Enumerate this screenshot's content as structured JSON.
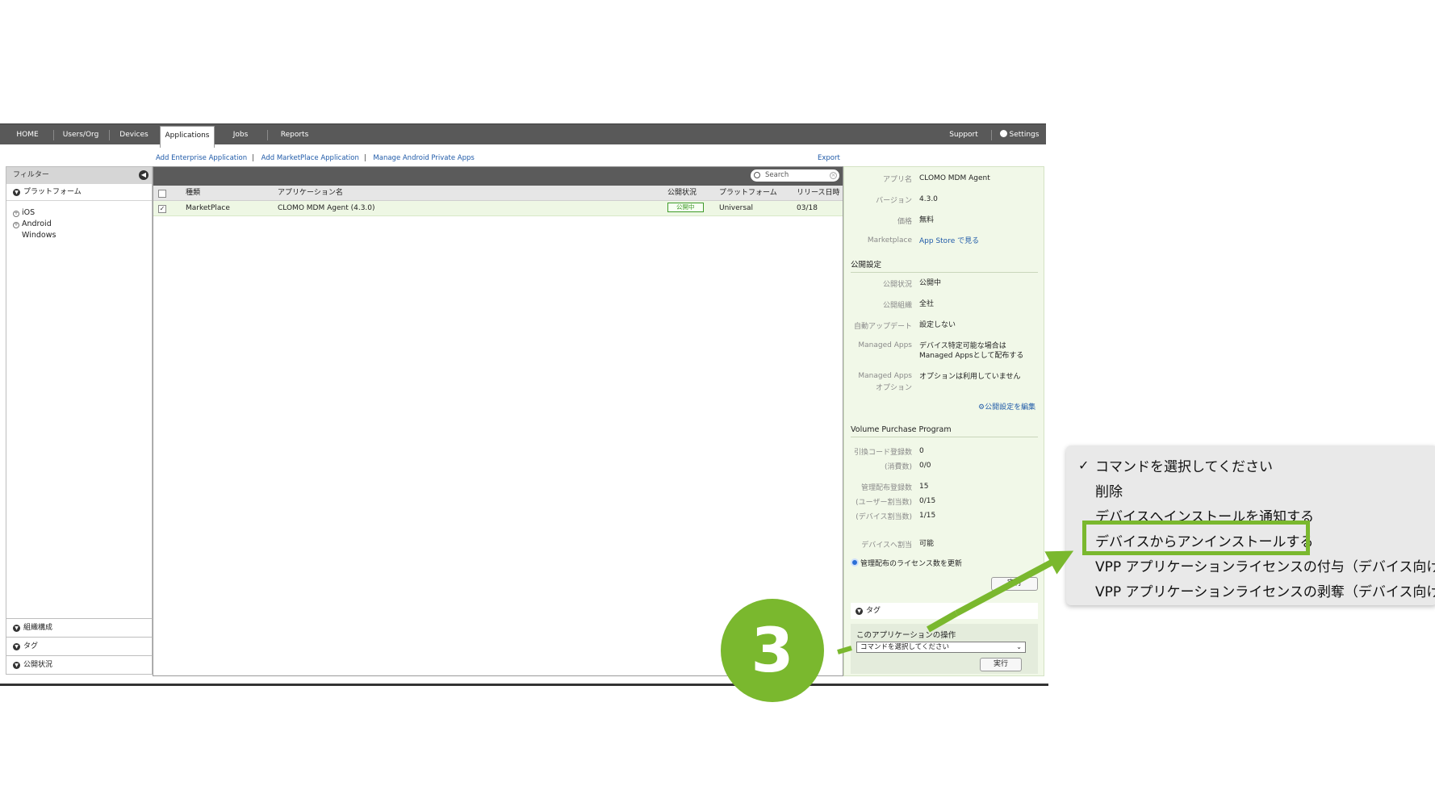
{
  "nav": {
    "tabs": [
      "HOME",
      "Users/Org",
      "Devices",
      "Applications",
      "Jobs",
      "Reports"
    ],
    "active": "Applications",
    "support": "Support",
    "settings": "Settings"
  },
  "actions": {
    "add_enterprise": "Add Enterprise Application",
    "add_marketplace": "Add MarketPlace Application",
    "manage_android": "Manage Android Private Apps",
    "export": "Export"
  },
  "filter": {
    "title": "フィルター",
    "platform_section": "プラットフォーム",
    "platforms": [
      "iOS",
      "Android",
      "Windows"
    ],
    "bottom_sections": [
      "組織構成",
      "タグ",
      "公開状況"
    ]
  },
  "search": {
    "placeholder": "Search"
  },
  "table": {
    "columns": [
      "種類",
      "アプリケーション名",
      "公開状況",
      "プラットフォーム",
      "リリース日時"
    ],
    "rows": [
      {
        "type": "MarketPlace",
        "name": "CLOMO MDM Agent (4.3.0)",
        "status": "公開中",
        "platform": "Universal",
        "release": "03/18"
      }
    ]
  },
  "detail": {
    "app_name_label": "アプリ名",
    "app_name": "CLOMO MDM Agent",
    "version_label": "バージョン",
    "version": "4.3.0",
    "price_label": "価格",
    "price": "無料",
    "marketplace_label": "Marketplace",
    "marketplace_link": "App Store で見る",
    "publish_section": "公開設定",
    "pub_status_label": "公開状況",
    "pub_status": "公開中",
    "pub_org_label": "公開組織",
    "pub_org": "全社",
    "auto_update_label": "自動アップデート",
    "auto_update": "設定しない",
    "managed_apps_label": "Managed Apps",
    "managed_apps_line1": "デバイス特定可能な場合は",
    "managed_apps_line2": "Managed Appsとして配布する",
    "managed_opt_label1": "Managed Apps",
    "managed_opt_label2": "オプション",
    "managed_opt": "オプションは利用していません",
    "edit_link": "公開設定を編集",
    "vpp_section": "Volume Purchase Program",
    "redeem_label": "引換コード登録数",
    "redeem": "0",
    "consumed_label": "(消費数)",
    "consumed": "0/0",
    "managed_reg_label": "管理配布登録数",
    "managed_reg": "15",
    "user_assign_label": "(ユーザー割当数)",
    "user_assign": "0/15",
    "device_assign_label": "(デバイス割当数)",
    "device_assign": "1/15",
    "device_allowed_label": "デバイスへ割当",
    "device_allowed": "可能",
    "radio_label": "管理配布のライセンス数を更新",
    "run_button": "実行",
    "tag_section": "タグ",
    "op_title": "このアプリケーションの操作",
    "op_selected": "コマンドを選択してください",
    "op_run": "実行"
  },
  "dropdown": {
    "items": [
      "コマンドを選択してください",
      "削除",
      "デバイスへインストールを通知する",
      "デバイスからアンインストールする",
      "VPP アプリケーションライセンスの付与（デバイス向け）",
      "VPP アプリケーションライセンスの剥奪（デバイス向け）"
    ],
    "checked_index": 0,
    "highlighted_index": 3
  },
  "callout": {
    "step": "3",
    "color": "#7ab82e"
  }
}
